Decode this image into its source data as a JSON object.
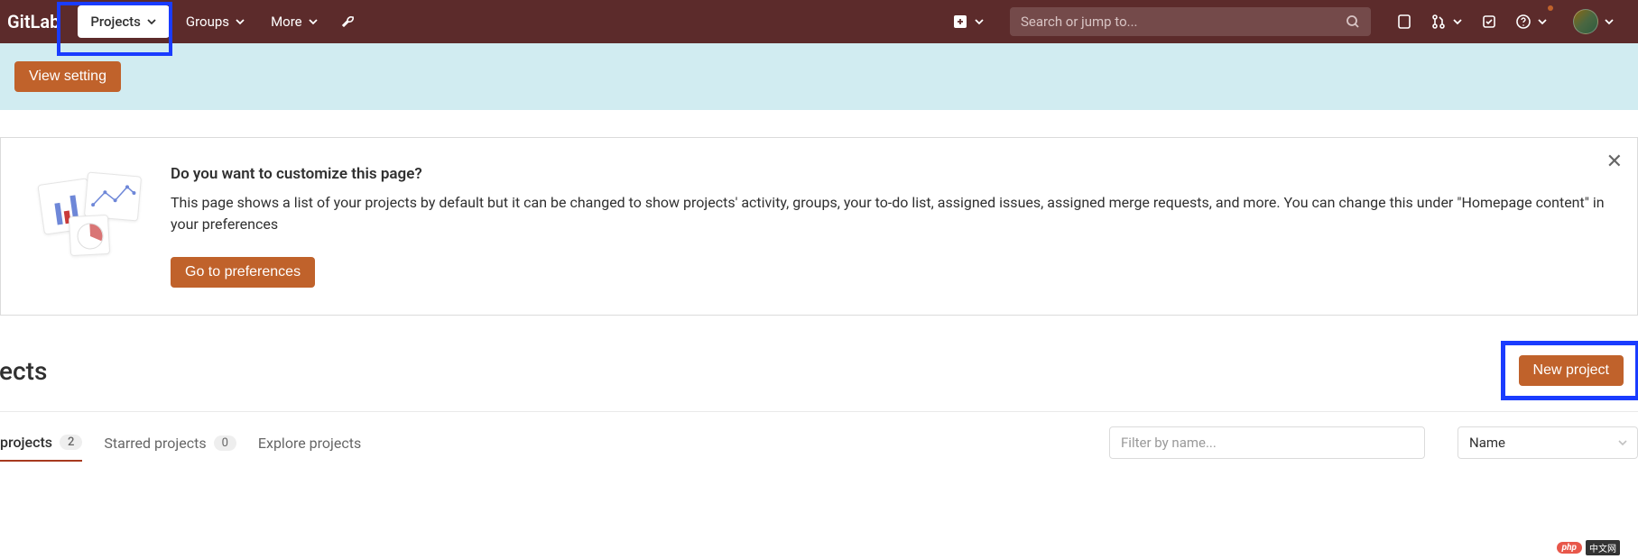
{
  "navbar": {
    "logo": "GitLab",
    "projects": "Projects",
    "groups": "Groups",
    "more": "More",
    "search_placeholder": "Search or jump to..."
  },
  "banner": {
    "view_setting": "View setting"
  },
  "customize": {
    "title": "Do you want to customize this page?",
    "desc": "This page shows a list of your projects by default but it can be changed to show projects' activity, groups, your to-do list, assigned issues, assigned merge requests, and more. You can change this under \"Homepage content\" in your preferences",
    "button": "Go to preferences"
  },
  "heading": {
    "title": "jects",
    "new_project": "New project"
  },
  "tabs": {
    "your_projects": "projects",
    "your_count": "2",
    "starred": "Starred projects",
    "starred_count": "0",
    "explore": "Explore projects",
    "filter_placeholder": "Filter by name...",
    "sort": "Name"
  },
  "watermark": {
    "php": "php",
    "cn": "中文网"
  }
}
